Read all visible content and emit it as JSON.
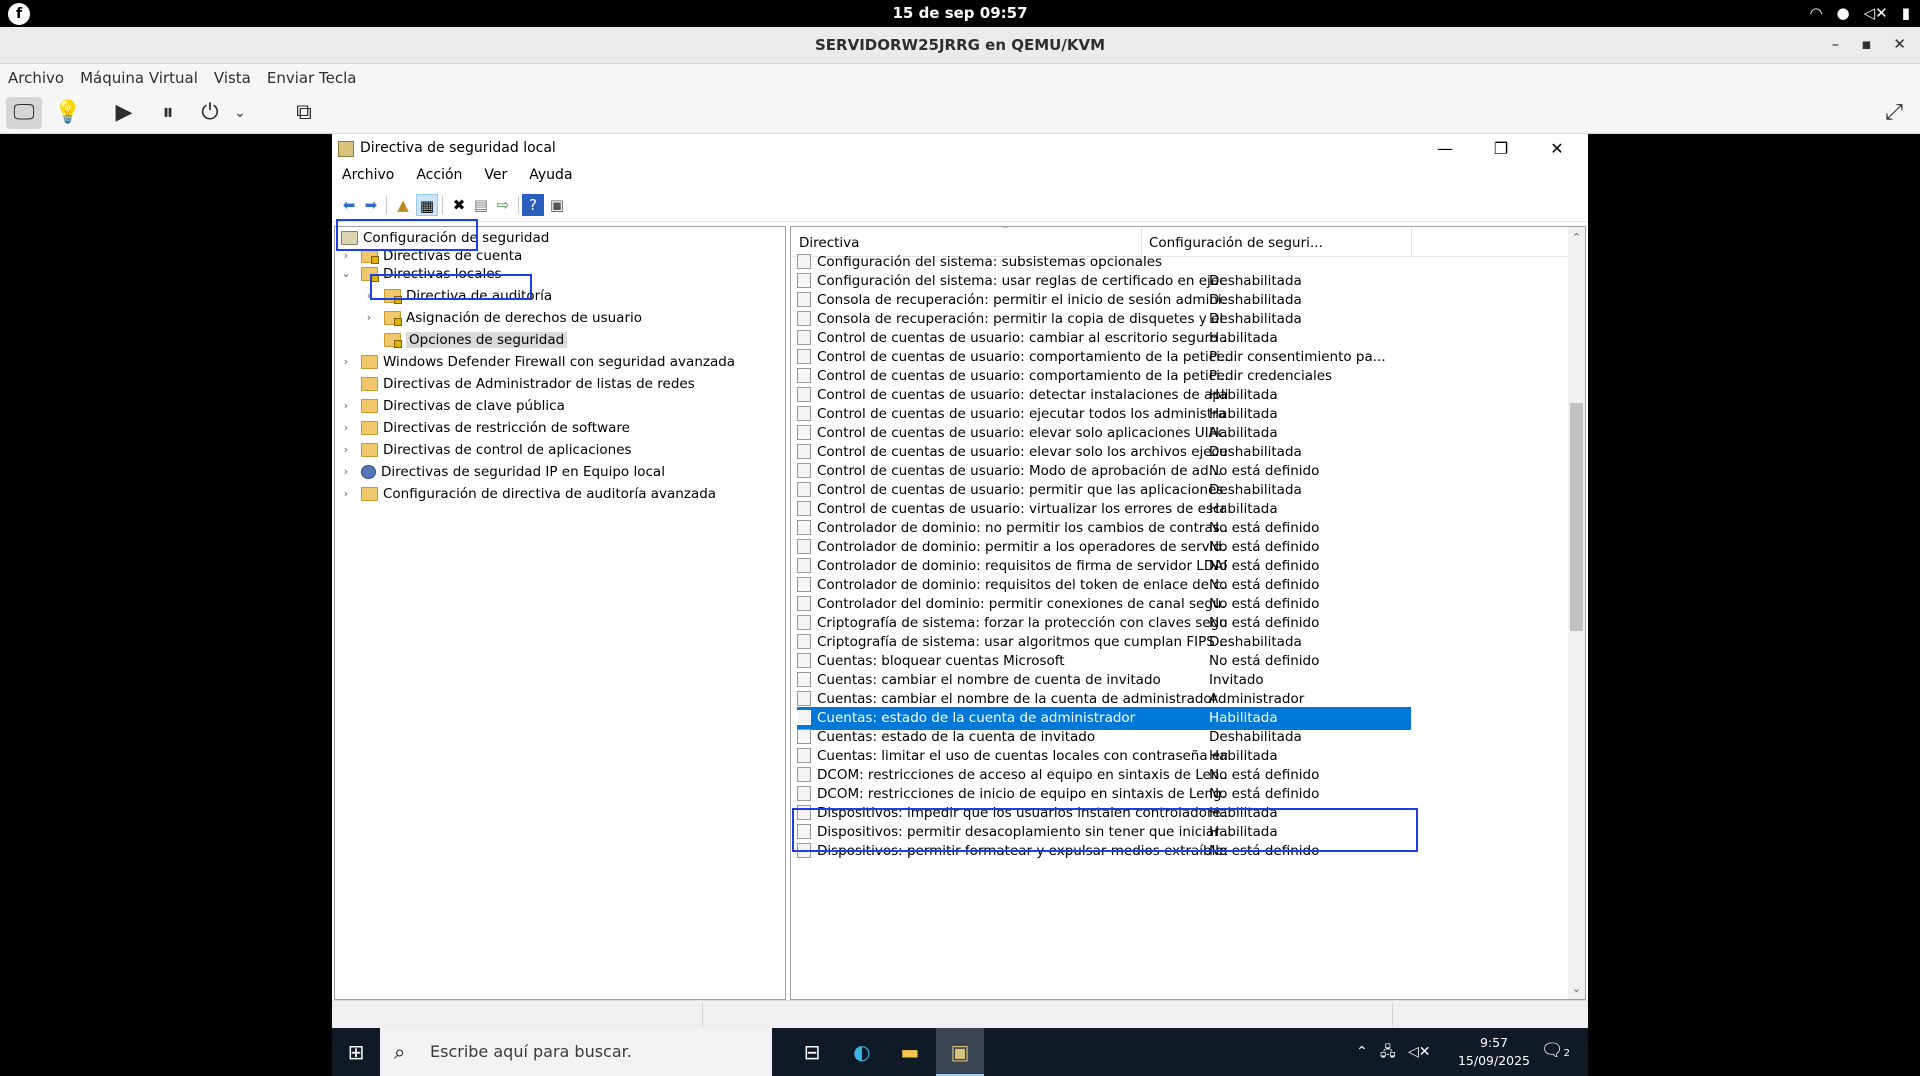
{
  "gnome": {
    "clock": "15 de sep  09:57"
  },
  "vm": {
    "title": "SERVIDORW25JRRG en QEMU/KVM",
    "menu": [
      "Archivo",
      "Máquina Virtual",
      "Vista",
      "Enviar Tecla"
    ]
  },
  "secpol": {
    "title": "Directiva de seguridad local",
    "menu": [
      "Archivo",
      "Acción",
      "Ver",
      "Ayuda"
    ],
    "tree": {
      "root": "Configuración de seguridad",
      "items": [
        "Directivas de cuenta",
        "Directivas locales",
        "Directiva de auditoría",
        "Asignación de derechos de usuario",
        "Opciones de seguridad",
        "Windows Defender Firewall con seguridad avanzada",
        "Directivas de Administrador de listas de redes",
        "Directivas de clave pública",
        "Directivas de restricción de software",
        "Directivas de control de aplicaciones",
        "Directivas de seguridad IP en Equipo local",
        "Configuración de directiva de auditoría avanzada"
      ]
    },
    "list": {
      "col_policy": "Directiva",
      "col_setting": "Configuración de seguri...",
      "rows": [
        {
          "name": "Configuración del sistema: subsistemas opcionales",
          "value": ""
        },
        {
          "name": "Configuración del sistema: usar reglas de certificado en ejec...",
          "value": "Deshabilitada"
        },
        {
          "name": "Consola de recuperación: permitir el inicio de sesión admini...",
          "value": "Deshabilitada"
        },
        {
          "name": "Consola de recuperación: permitir la copia de disquetes y el ...",
          "value": "Deshabilitada"
        },
        {
          "name": "Control de cuentas de usuario: cambiar al escritorio seguro ...",
          "value": "Habilitada"
        },
        {
          "name": "Control de cuentas de usuario: comportamiento de la petici...",
          "value": "Pedir consentimiento pa..."
        },
        {
          "name": "Control de cuentas de usuario: comportamiento de la petici...",
          "value": "Pedir credenciales"
        },
        {
          "name": "Control de cuentas de usuario: detectar instalaciones de apli...",
          "value": "Habilitada"
        },
        {
          "name": "Control de cuentas de usuario: ejecutar todos los administra...",
          "value": "Habilitada"
        },
        {
          "name": "Control de cuentas de usuario: elevar solo aplicaciones UIAc...",
          "value": "Habilitada"
        },
        {
          "name": "Control de cuentas de usuario: elevar solo los archivos ejecu...",
          "value": "Deshabilitada"
        },
        {
          "name": "Control de cuentas de usuario: Modo de aprobación de ad...",
          "value": "No está definido"
        },
        {
          "name": "Control de cuentas de usuario: permitir que las aplicaciones ...",
          "value": "Deshabilitada"
        },
        {
          "name": "Control de cuentas de usuario: virtualizar los errores de escri...",
          "value": "Habilitada"
        },
        {
          "name": "Controlador de dominio: no permitir los cambios de contras...",
          "value": "No está definido"
        },
        {
          "name": "Controlador de dominio: permitir a los operadores de servid...",
          "value": "No está definido"
        },
        {
          "name": "Controlador de dominio: requisitos de firma de servidor LDAP",
          "value": "No está definido"
        },
        {
          "name": "Controlador de dominio: requisitos del token de enlace de c...",
          "value": "No está definido"
        },
        {
          "name": "Controlador del dominio: permitir conexiones de canal segu...",
          "value": "No está definido"
        },
        {
          "name": "Criptografía de sistema: forzar la protección con claves segu...",
          "value": "No está definido"
        },
        {
          "name": "Criptografía de sistema: usar algoritmos que cumplan FIPS ...",
          "value": "Deshabilitada"
        },
        {
          "name": "Cuentas: bloquear cuentas Microsoft",
          "value": "No está definido"
        },
        {
          "name": "Cuentas: cambiar el nombre de cuenta de invitado",
          "value": "Invitado"
        },
        {
          "name": "Cuentas: cambiar el nombre de la cuenta de administrador",
          "value": "Administrador"
        },
        {
          "name": "Cuentas: estado de la cuenta de administrador",
          "value": "Habilitada"
        },
        {
          "name": "Cuentas: estado de la cuenta de invitado",
          "value": "Deshabilitada"
        },
        {
          "name": "Cuentas: limitar el uso de cuentas locales con contraseña en...",
          "value": "Habilitada"
        },
        {
          "name": "DCOM: restricciones de acceso al equipo en sintaxis de Len...",
          "value": "No está definido"
        },
        {
          "name": "DCOM: restricciones de inicio de equipo en sintaxis de Leng...",
          "value": "No está definido"
        },
        {
          "name": "Dispositivos: impedir que los usuarios instalen controladore...",
          "value": "Habilitada"
        },
        {
          "name": "Dispositivos: permitir desacoplamiento sin tener que iniciar ...",
          "value": "Habilitada"
        },
        {
          "name": "Dispositivos: permitir formatear y expulsar medios extraíbles",
          "value": "No está definido"
        }
      ]
    }
  },
  "taskbar": {
    "search_placeholder": "Escribe aquí para buscar.",
    "time": "9:57",
    "date": "15/09/2025",
    "notifications": "2"
  }
}
